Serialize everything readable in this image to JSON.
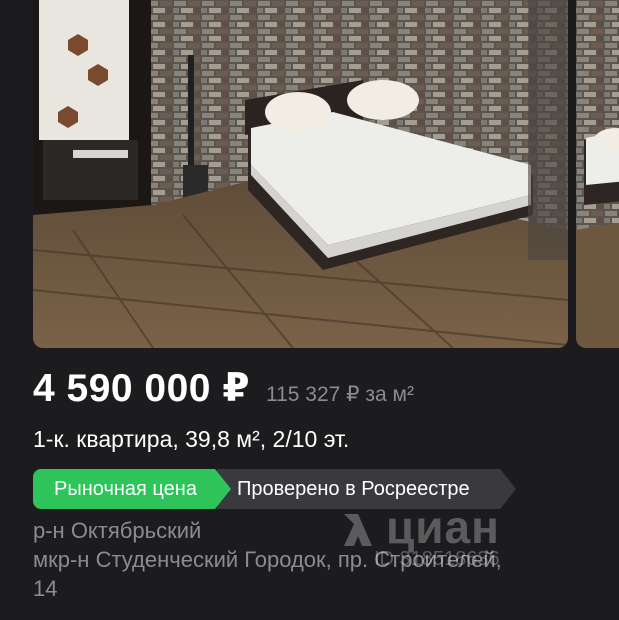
{
  "gallery": {
    "photos": [
      {
        "icon": "apartment-photo"
      },
      {
        "icon": "apartment-photo-next"
      }
    ]
  },
  "listing": {
    "price": "4 590 000 ₽",
    "price_per_m2": "115 327 ₽ за м²",
    "title": "1-к. квартира, 39,8 м², 2/10 эт.",
    "badges": {
      "market": "Рыночная цена",
      "rosreestr": "Проверено в Росреестре"
    },
    "address": {
      "district": "р-н Октябрьский",
      "street": "мкр-н Студенческий Городок, пр. Строителей,",
      "house": "14"
    }
  },
  "watermark": {
    "brand": "циан",
    "id": "ID 318518636"
  },
  "colors": {
    "background": "#1c1c1e",
    "market_badge": "#2fc45a",
    "rosreestr_badge": "#3a3a3e",
    "secondary_text": "#8b8b90"
  }
}
